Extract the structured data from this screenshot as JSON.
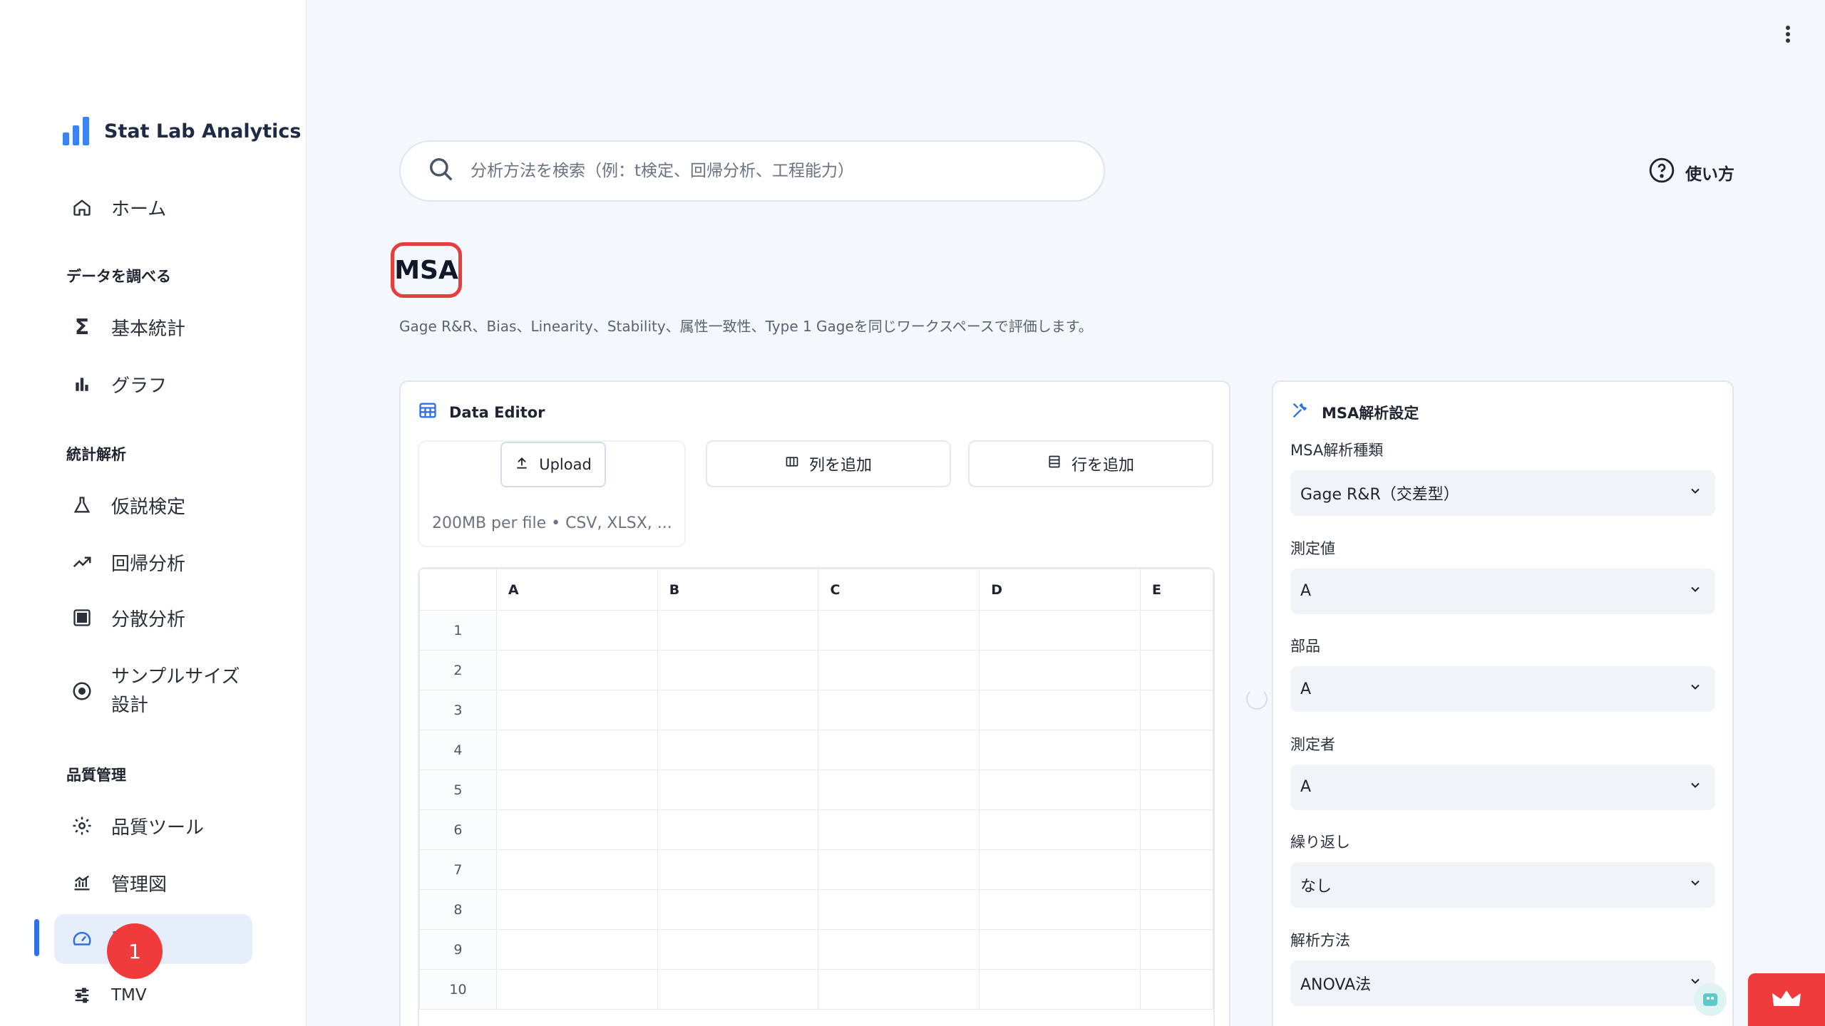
{
  "app": {
    "brand": "Stat Lab Analytics"
  },
  "sidebar": {
    "home": "ホーム",
    "sections": {
      "explore": "データを調べる",
      "stats": "統計解析",
      "quality": "品質管理"
    },
    "items": {
      "basic_stats": "基本統計",
      "graph": "グラフ",
      "hypothesis": "仮説検定",
      "regression": "回帰分析",
      "anova": "分散分析",
      "sample_size_line1": "サンプルサイズ",
      "sample_size_line2": "設計",
      "quality_tools": "品質ツール",
      "control_chart": "管理図",
      "msa": "M",
      "tmv": "TMV"
    },
    "badge": "1"
  },
  "search": {
    "placeholder": "分析方法を検索（例：t検定、回帰分析、工程能力）"
  },
  "help": {
    "label": "使い方"
  },
  "page": {
    "title": "MSA",
    "subtitle": "Gage R&R、Bias、Linearity、Stability、属性一致性、Type 1 Gageを同じワークスペースで評価します。"
  },
  "editor": {
    "title": "Data Editor",
    "upload_label": "Upload",
    "upload_note": "200MB per file • CSV, XLSX, ...",
    "add_column": "列を追加",
    "add_row": "行を追加",
    "columns": [
      "A",
      "B",
      "C",
      "D",
      "E"
    ],
    "rows": [
      "1",
      "2",
      "3",
      "4",
      "5",
      "6",
      "7",
      "8",
      "9",
      "10"
    ]
  },
  "settings": {
    "title": "MSA解析設定",
    "fields": [
      {
        "label": "MSA解析種類",
        "value": "Gage R&R（交差型）"
      },
      {
        "label": "測定値",
        "value": "A"
      },
      {
        "label": "部品",
        "value": "A"
      },
      {
        "label": "測定者",
        "value": "A"
      },
      {
        "label": "繰り返し",
        "value": "なし"
      },
      {
        "label": "解析方法",
        "value": "ANOVA法"
      }
    ]
  },
  "colors": {
    "accent": "#2f6fe4",
    "badge": "#ef3b3b",
    "title_border": "#e53e3e"
  }
}
